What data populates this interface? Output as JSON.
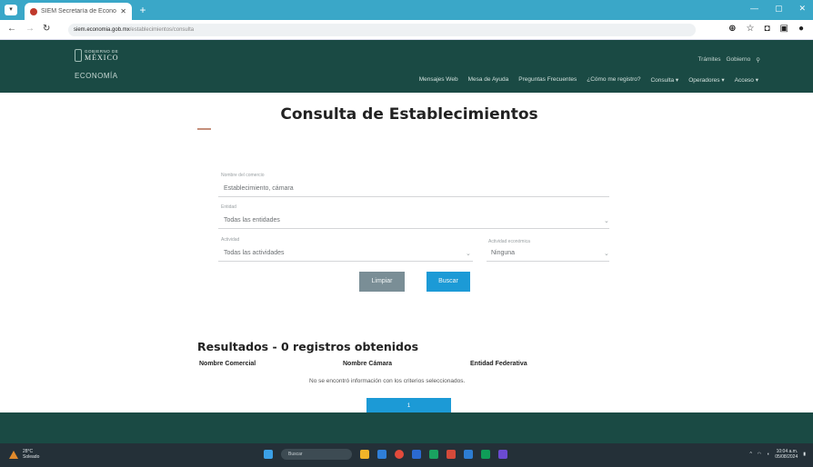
{
  "browser": {
    "tab_title": "SIEM Secretaría de Economía",
    "tab_close": "✕",
    "new_tab": "+",
    "url_host": "siem.economia.gob.mx",
    "url_path": "/establecimientos/consulta",
    "window_controls": [
      "—",
      "▢",
      "✕"
    ]
  },
  "header": {
    "logo_top": "GOBIERNO DE",
    "logo_main": "MÉXICO",
    "logo_sub": "ECONOMÍA",
    "top_links": [
      "Trámites",
      "Gobierno"
    ],
    "nav": [
      "Mensajes Web",
      "Mesa de Ayuda",
      "Preguntas Frecuentes",
      "¿Cómo me registro?",
      "Consulta ▾",
      "Operadores ▾",
      "Acceso ▾"
    ]
  },
  "page": {
    "title": "Consulta de Establecimientos",
    "form": {
      "name_label": "Nombre del comercio",
      "name_placeholder": "Establecimiento, cámara",
      "state_label": "Entidad",
      "state_value": "Todas las entidades",
      "activity_label": "Actividad",
      "activity_value": "Todas las actividades",
      "scian_label": "Actividad económica",
      "scian_value": "Ninguna"
    },
    "clear_button": "Limpiar",
    "search_button": "Buscar",
    "results_title": "Resultados - 0 registros obtenidos",
    "columns": [
      "Nombre Comercial",
      "Nombre Cámara",
      "Entidad Federativa"
    ],
    "empty_message": "No se encontró información con los criterios seleccionados.",
    "pager_label": "1"
  },
  "taskbar": {
    "weather_temp": "28°C",
    "weather_desc": "Soleado",
    "search_placeholder": "Buscar",
    "time": "10:04 a.m.",
    "date": "05/08/2024"
  },
  "colors": {
    "header_bg": "#1a4a44",
    "tabbar_bg": "#3aa7c8",
    "primary_button": "#1c9ad6",
    "secondary_button": "#7a8e96"
  }
}
